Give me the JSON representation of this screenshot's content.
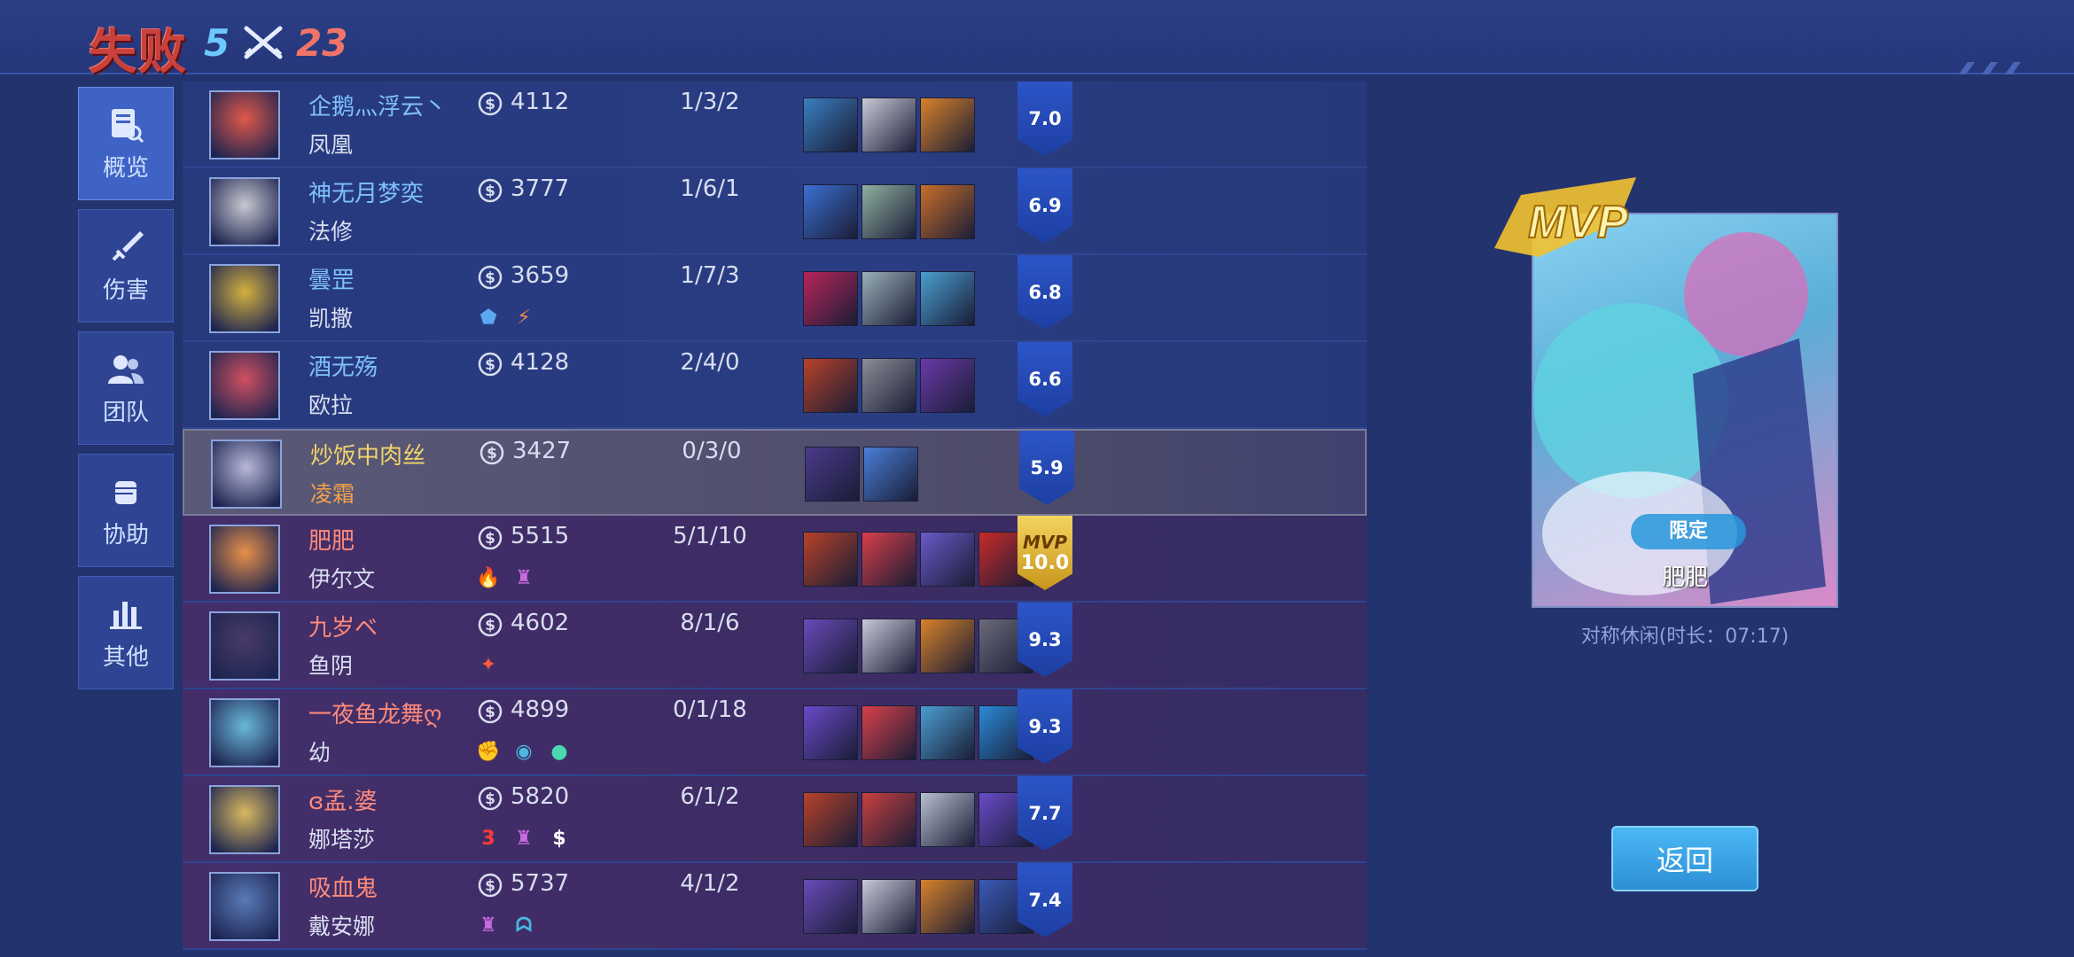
{
  "header": {
    "result": "失败",
    "ally_score": "5",
    "enemy_score": "23"
  },
  "sidebar": {
    "tabs": [
      {
        "label": "概览",
        "icon": "overview-icon",
        "active": true
      },
      {
        "label": "伤害",
        "icon": "sword-icon",
        "active": false
      },
      {
        "label": "团队",
        "icon": "team-icon",
        "active": false
      },
      {
        "label": "协助",
        "icon": "fist-icon",
        "active": false
      },
      {
        "label": "其他",
        "icon": "bar-chart-icon",
        "active": false
      }
    ]
  },
  "players": [
    {
      "name": "企鹅灬浮云丶",
      "hero": "凤凰",
      "gold": "4112",
      "kda": "1/3/2",
      "rating": "7.0",
      "team": "ally",
      "badges": [],
      "items": [
        "#3a7ec0",
        "#c9c9d6",
        "#d9822a"
      ],
      "avatar": "#e0584a"
    },
    {
      "name": "神无月梦奕",
      "hero": "法修",
      "gold": "3777",
      "kda": "1/6/1",
      "rating": "6.9",
      "team": "ally",
      "badges": [],
      "items": [
        "#3b6fd1",
        "#8fb0a0",
        "#c96e2a"
      ],
      "avatar": "#c8c8d0"
    },
    {
      "name": "曇罡",
      "hero": "凯撒",
      "gold": "3659",
      "kda": "1/7/3",
      "rating": "6.8",
      "team": "ally",
      "badges": [
        {
          "symbol": "⬟",
          "color": "#5aa8f0"
        },
        {
          "symbol": "⚡",
          "color": "#f08a4a"
        }
      ],
      "items": [
        "#b8245a",
        "#9ab0b8",
        "#4a9ed0"
      ],
      "avatar": "#d4b040"
    },
    {
      "name": "酒无殇",
      "hero": "欧拉",
      "gold": "4128",
      "kda": "2/4/0",
      "rating": "6.6",
      "team": "ally",
      "badges": [],
      "items": [
        "#b8422a",
        "#8c8f96",
        "#6a3aa8"
      ],
      "avatar": "#d05060"
    },
    {
      "name": "炒饭中肉丝",
      "hero": "凌霜",
      "gold": "3427",
      "kda": "0/3/0",
      "rating": "5.9",
      "team": "me",
      "badges": [],
      "items": [
        "#4a3a8a",
        "#4a7ed8"
      ],
      "avatar": "#b8b8d8"
    },
    {
      "name": "肥肥",
      "hero": "伊尔文",
      "gold": "5515",
      "kda": "5/1/10",
      "rating": "10.0",
      "team": "enemy",
      "mvp": true,
      "badges": [
        {
          "symbol": "🔥",
          "color": "#ff6a4a"
        },
        {
          "symbol": "♜",
          "color": "#c86ae0"
        }
      ],
      "items": [
        "#b8422a",
        "#d8404a",
        "#6a5ac8",
        "#c82a2a"
      ],
      "avatar": "#e8904a"
    },
    {
      "name": "九岁ベ",
      "hero": "鱼阴",
      "gold": "4602",
      "kda": "8/1/6",
      "rating": "9.3",
      "team": "enemy",
      "badges": [
        {
          "symbol": "✦",
          "color": "#ff5a3a"
        }
      ],
      "items": [
        "#6a4ab8",
        "#c8c8d8",
        "#d9822a",
        "#6a6a7a"
      ],
      "avatar": "#4a3a6a"
    },
    {
      "name": "一夜鱼龙舞ღ",
      "hero": "幼",
      "gold": "4899",
      "kda": "0/1/18",
      "rating": "9.3",
      "team": "enemy",
      "badges": [
        {
          "symbol": "✊",
          "color": "#6ad84a"
        },
        {
          "symbol": "◉",
          "color": "#4ab8e0"
        },
        {
          "symbol": "●",
          "color": "#4ad8b0"
        }
      ],
      "items": [
        "#6a4ac8",
        "#d8404a",
        "#4a9ed0",
        "#2a8ad8"
      ],
      "avatar": "#6ab8d8"
    },
    {
      "name": "ɞ孟.婆",
      "hero": "娜塔莎",
      "gold": "5820",
      "kda": "6/1/2",
      "rating": "7.7",
      "team": "enemy",
      "badges": [
        {
          "symbol": "3",
          "color": "#ff3a3a"
        },
        {
          "symbol": "♜",
          "color": "#c86ae0"
        },
        {
          "symbol": "$",
          "color": "#ffffff"
        }
      ],
      "items": [
        "#b8422a",
        "#c84040",
        "#b8c0d0",
        "#6a4ac8"
      ],
      "avatar": "#d8b860"
    },
    {
      "name": "吸血鬼",
      "hero": "戴安娜",
      "gold": "5737",
      "kda": "4/1/2",
      "rating": "7.4",
      "team": "enemy",
      "badges": [
        {
          "symbol": "♜",
          "color": "#c86ae0"
        },
        {
          "symbol": "ᗣ",
          "color": "#4ab8e0"
        }
      ],
      "items": [
        "#6a4ab8",
        "#c8c8d8",
        "#d9822a",
        "#3a5ab8"
      ],
      "avatar": "#5a7ab8"
    }
  ],
  "mvp_card": {
    "logo_text": "MVP",
    "player_name": "肥肥",
    "skin_tag": "限定",
    "match_info": "对称休闲(时长：07:17)"
  },
  "buttons": {
    "back": "返回"
  },
  "colors": {
    "defeat_red": "#c9413c",
    "ally_blue": "#7ec0ff",
    "enemy_red": "#ff8a7a",
    "self_gold": "#f2d36a"
  }
}
